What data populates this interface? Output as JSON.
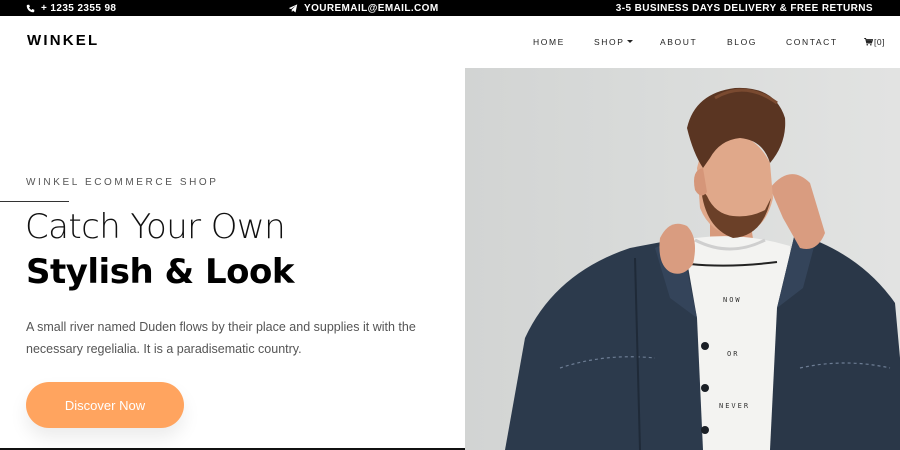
{
  "topbar": {
    "phone": "+ 1235 2355 98",
    "email": "YOUREMAIL@EMAIL.COM",
    "delivery": "3-5 BUSINESS DAYS DELIVERY & FREE RETURNS",
    "phone_icon": "phone-icon",
    "email_icon": "paper-plane-icon"
  },
  "navbar": {
    "logo": "WINKEL",
    "items": [
      {
        "label": "HOME"
      },
      {
        "label": "SHOP",
        "has_dropdown": true
      },
      {
        "label": "ABOUT"
      },
      {
        "label": "BLOG"
      },
      {
        "label": "CONTACT"
      }
    ],
    "cart_icon": "cart-icon",
    "cart_count": "[0]"
  },
  "hero": {
    "eyebrow": "WINKEL ECOMMERCE SHOP",
    "headline_light": "Catch Your Own",
    "headline_bold": "Stylish & Look",
    "description": "A small river named Duden flows by their place and supplies it with the necessary regelialia. It is a paradisematic country.",
    "cta_label": "Discover Now",
    "shirt_words": [
      "NOW",
      "OR",
      "NEVER"
    ]
  },
  "colors": {
    "accent": "#ffa45f",
    "topbar_bg": "#000000",
    "image_bg": "#d9dbda",
    "jacket": "#2c3a4c"
  }
}
